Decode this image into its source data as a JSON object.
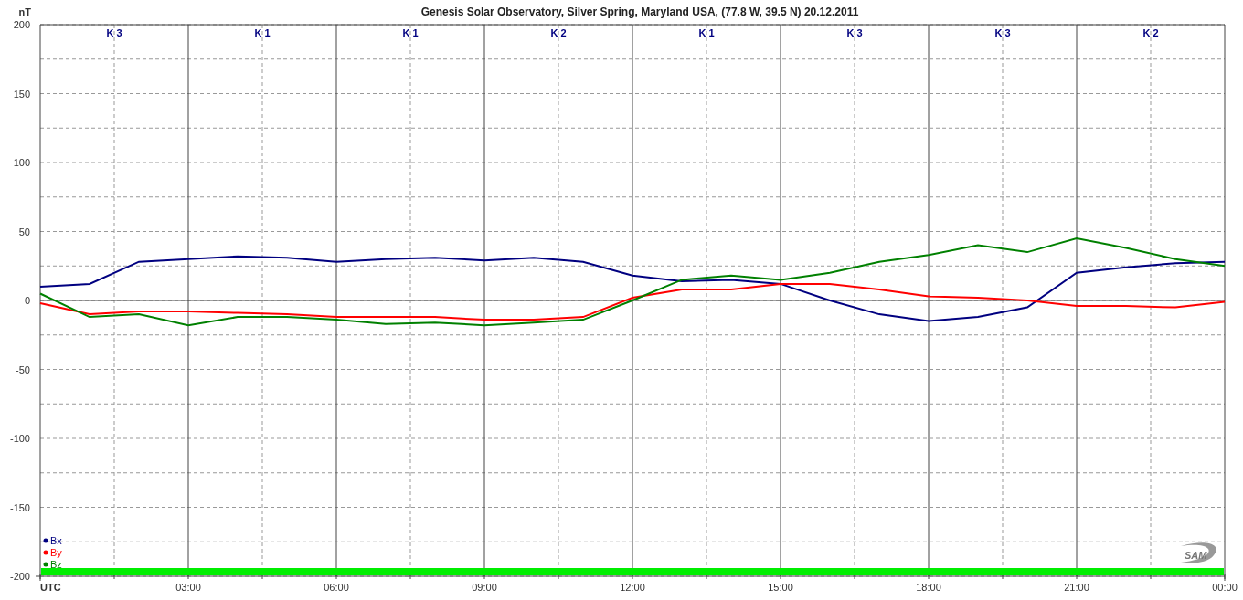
{
  "chart": {
    "chart_data": {
      "type": "line",
      "title": "Genesis Solar Observatory, Silver Spring, Maryland USA, (77.8 W, 39.5 N)  20.12.2011",
      "ylabel": "nT",
      "x": [
        0,
        1,
        2,
        3,
        4,
        5,
        6,
        7,
        8,
        9,
        10,
        11,
        12,
        13,
        14,
        15,
        16,
        17,
        18,
        19,
        20,
        21,
        22,
        23,
        24
      ],
      "series": [
        {
          "name": "Bx",
          "color": "#000080",
          "values": [
            10,
            12,
            28,
            30,
            32,
            31,
            28,
            30,
            31,
            29,
            31,
            28,
            18,
            14,
            15,
            12,
            0,
            -10,
            -15,
            -12,
            -5,
            20,
            24,
            27,
            28
          ]
        },
        {
          "name": "By",
          "color": "#ff0000",
          "values": [
            -2,
            -10,
            -8,
            -8,
            -9,
            -10,
            -12,
            -12,
            -12,
            -14,
            -14,
            -12,
            2,
            8,
            8,
            12,
            12,
            8,
            3,
            2,
            0,
            -4,
            -4,
            -5,
            -1
          ]
        },
        {
          "name": "Bz",
          "color": "#008000",
          "values": [
            5,
            -12,
            -10,
            -18,
            -12,
            -12,
            -14,
            -17,
            -16,
            -18,
            -16,
            -14,
            0,
            15,
            18,
            15,
            20,
            28,
            33,
            40,
            35,
            45,
            38,
            30,
            25
          ]
        }
      ],
      "xlim": [
        0,
        24
      ],
      "ylim": [
        -200,
        200
      ],
      "xticks": [
        {
          "value": 0,
          "label": "UTC"
        },
        {
          "value": 3,
          "label": "03:00"
        },
        {
          "value": 6,
          "label": "06:00"
        },
        {
          "value": 9,
          "label": "09:00"
        },
        {
          "value": 12,
          "label": "12:00"
        },
        {
          "value": 15,
          "label": "15:00"
        },
        {
          "value": 18,
          "label": "18:00"
        },
        {
          "value": 21,
          "label": "21:00"
        },
        {
          "value": 24,
          "label": "00:00"
        }
      ],
      "yticks": [
        -200,
        -150,
        -100,
        -50,
        0,
        50,
        100,
        150,
        200
      ],
      "grid": true
    },
    "k_indices": [
      "K 3",
      "K 1",
      "K 1",
      "K 2",
      "K 1",
      "K 3",
      "K 3",
      "K 2"
    ],
    "logo": "SAM"
  }
}
